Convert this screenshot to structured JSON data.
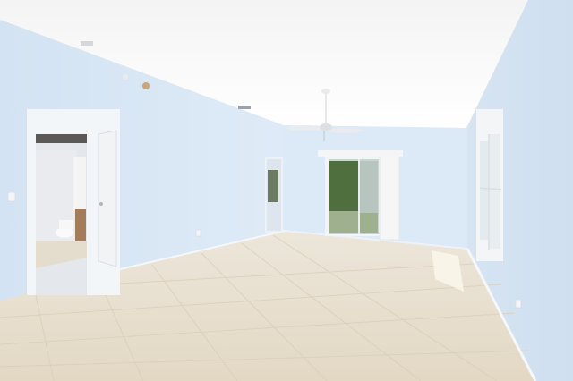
{
  "scene": {
    "kind": "photo",
    "colors": {
      "ceiling": "#fbfbfb",
      "wall": "#dbe9f6",
      "wall_shadow": "#cfdeed",
      "floor": "#e6dccb",
      "floor_grout": "#d7cbb6",
      "trim": "#f4f6f8",
      "door": "#f1f3f5",
      "bath_wall": "#e7eaee",
      "window_glass": "#eef2f2",
      "foliage": "#4f6f3f",
      "blind": "#f6f6f6"
    }
  }
}
